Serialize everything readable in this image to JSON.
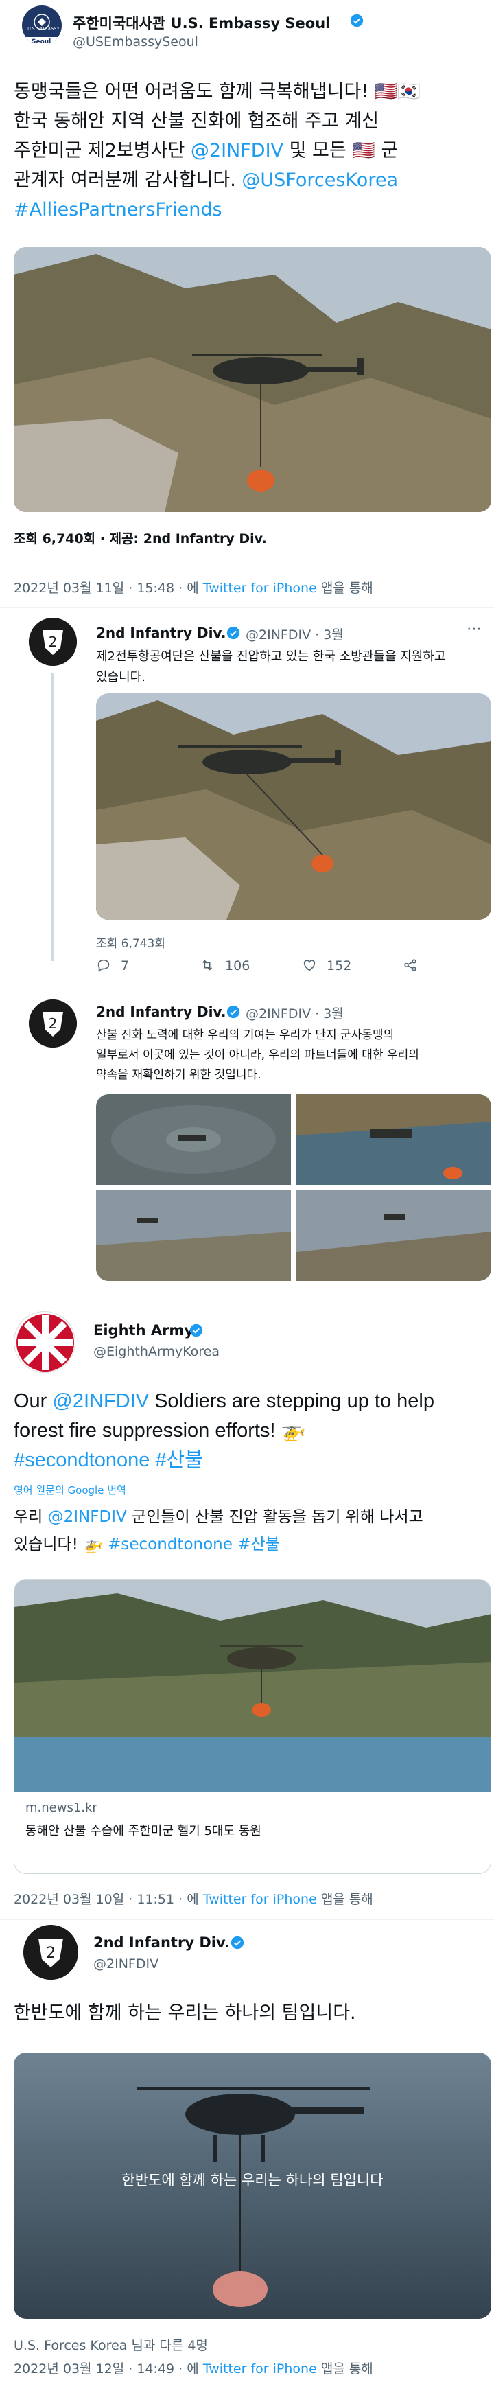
{
  "tweet1": {
    "name": "주한미국대사관 U.S. Embassy Seoul",
    "handle": "@USEmbassySeoul",
    "avatar_text_top": "U.S. EMBASSY",
    "avatar_text_bottom": "Seoul",
    "text_line1": "동맹국들은 어떤 어려움도 함께 극복해냅니다! 🇺🇸🇰🇷",
    "text_line2": "한국 동해안 지역 산불 진화에 협조해 주고 계신",
    "text_line3_a": "주한미군 제2보병사단 ",
    "text_line3_b": "@2INFDIV",
    "text_line3_c": " 및 모든 🇺🇸 군",
    "text_line4_a": "관계자 여러분께 감사합니다. ",
    "text_line4_b": "@USForcesKorea",
    "text_line5": "#AlliesPartnersFriends",
    "views": "조회 6,740회 · 제공: 2nd Infantry Div.",
    "meta_a": "2022년 03월 11일 · 15:48 · 에 ",
    "meta_b": "Twitter for iPhone",
    "meta_c": " 앱을 통해"
  },
  "quote1": {
    "name": "2nd Infantry Div.",
    "handle": "@2INFDIV · 3월",
    "text_line1": "제2전투항공여단은 산불을 진압하고 있는 한국 소방관들을 지원하고",
    "text_line2": "있습니다.",
    "views": "조회 6,743회",
    "reply_count": "7",
    "retweet_count": "106",
    "like_count": "152"
  },
  "quote2": {
    "name": "2nd Infantry Div.",
    "handle": "@2INFDIV · 3월",
    "text_line1": "산불 진화 노력에 대한 우리의 기여는 우리가 단지 군사동맹의",
    "text_line2": "일부로서 이곳에 있는 것이 아니라, 우리의 파트너들에 대한 우리의",
    "text_line3": "약속을 재확인하기 위한 것입니다."
  },
  "tweet2": {
    "name": "Eighth Army",
    "handle": "@EighthArmyKorea",
    "text_line1_a": "Our ",
    "text_line1_b": "@2INFDIV",
    "text_line1_c": " Soldiers are stepping up to help",
    "text_line2": "forest fire suppression efforts! 🚁",
    "text_line3": "#secondtonone #산불",
    "translate_label": "영어 원문의 Google 번역",
    "trans_line1_a": "우리 ",
    "trans_line1_b": "@2INFDIV",
    "trans_line1_c": " 군인들이 산불 진압 활동을 돕기 위해 나서고",
    "trans_line2_a": "있습니다! 🚁 ",
    "trans_line2_b": "#secondtonone #산불",
    "card_domain": "m.news1.kr",
    "card_title": "동해안 산불 수습에 주한미군 헬기 5대도 동원",
    "meta_a": "2022년 03월 10일 · 11:51 · 에 ",
    "meta_b": "Twitter for iPhone",
    "meta_c": " 앱을 통해"
  },
  "tweet3": {
    "name": "2nd Infantry Div.",
    "handle": "@2INFDIV",
    "text": "한반도에 함께 하는 우리는 하나의 팀입니다.",
    "video_caption": "한반도에 함께 하는 우리는 하나의 팀입니다",
    "tagged": "U.S. Forces Korea 님과 다른 4명",
    "meta_a": "2022년 03월 12일 · 14:49 · 에 ",
    "meta_b": "Twitter for iPhone",
    "meta_c": " 앱을 통해"
  }
}
